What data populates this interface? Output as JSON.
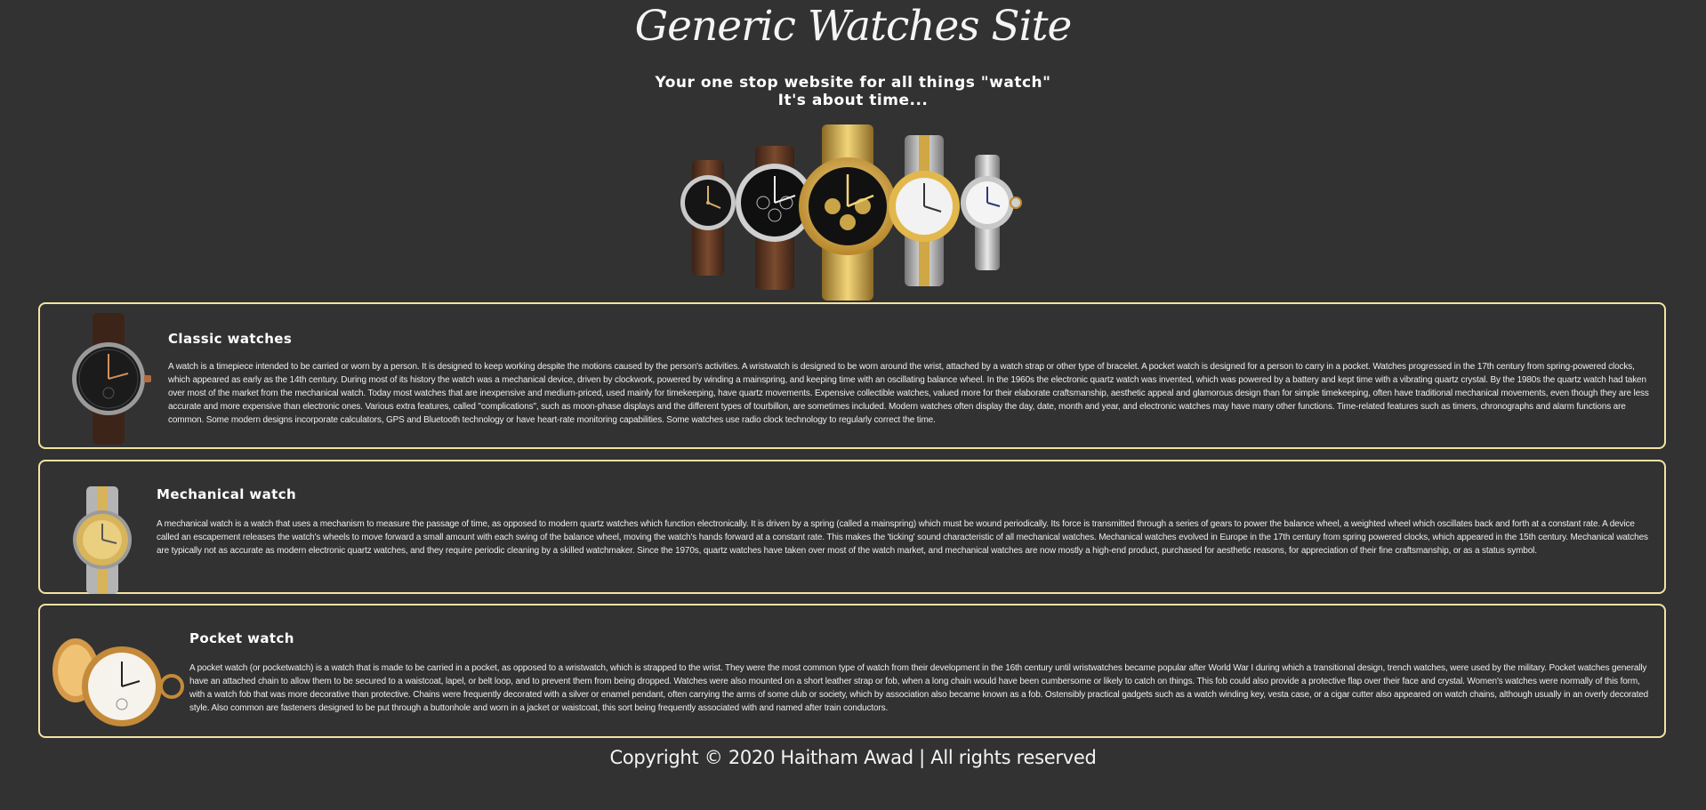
{
  "site": {
    "title": "Generic Watches Site",
    "tagline_line1": "Your one stop website for all things \"watch\"",
    "tagline_line2": "It's about time..."
  },
  "cards": [
    {
      "title": "Classic watches",
      "icon": "wristwatch-leather-icon",
      "text": "A watch is a timepiece intended to be carried or worn by a person. It is designed to keep working despite the motions caused by the person's activities. A wristwatch is designed to be worn around the wrist, attached by a watch strap or other type of bracelet. A pocket watch is designed for a person to carry in a pocket. Watches progressed in the 17th century from spring-powered clocks, which appeared as early as the 14th century. During most of its history the watch was a mechanical device, driven by clockwork, powered by winding a mainspring, and keeping time with an oscillating balance wheel. In the 1960s the electronic quartz watch was invented, which was powered by a battery and kept time with a vibrating quartz crystal. By the 1980s the quartz watch had taken over most of the market from the mechanical watch. Today most watches that are inexpensive and medium-priced, used mainly for timekeeping, have quartz movements. Expensive collectible watches, valued more for their elaborate craftsmanship, aesthetic appeal and glamorous design than for simple timekeeping, often have traditional mechanical movements, even though they are less accurate and more expensive than electronic ones. Various extra features, called \"complications\", such as moon-phase displays and the different types of tourbillon, are sometimes included. Modern watches often display the day, date, month and year, and electronic watches may have many other functions. Time-related features such as timers, chronographs and alarm functions are common. Some modern designs incorporate calculators, GPS and Bluetooth technology or have heart-rate monitoring capabilities. Some watches use radio clock technology to regularly correct the time."
    },
    {
      "title": "Mechanical watch",
      "icon": "wristwatch-gold-bracelet-icon",
      "text": "A mechanical watch is a watch that uses a mechanism to measure the passage of time, as opposed to modern quartz watches which function electronically. It is driven by a spring (called a mainspring) which must be wound periodically. Its force is transmitted through a series of gears to power the balance wheel, a weighted wheel which oscillates back and forth at a constant rate. A device called an escapement releases the watch's wheels to move forward a small amount with each swing of the balance wheel, moving the watch's hands forward at a constant rate. This makes the 'ticking' sound characteristic of all mechanical watches. Mechanical watches evolved in Europe in the 17th century from spring powered clocks, which appeared in the 15th century. Mechanical watches are typically not as accurate as modern electronic quartz watches, and they require periodic cleaning by a skilled watchmaker. Since the 1970s, quartz watches have taken over most of the watch market, and mechanical watches are now mostly a high-end product, purchased for aesthetic reasons, for appreciation of their fine craftsmanship, or as a status symbol."
    },
    {
      "title": "Pocket watch",
      "icon": "pocket-watch-icon",
      "text": "A pocket watch (or pocketwatch) is a watch that is made to be carried in a pocket, as opposed to a wristwatch, which is strapped to the wrist. They were the most common type of watch from their development in the 16th century until wristwatches became popular after World War I during which a transitional design, trench watches, were used by the military. Pocket watches generally have an attached chain to allow them to be secured to a waistcoat, lapel, or belt loop, and to prevent them from being dropped. Watches were also mounted on a short leather strap or fob, when a long chain would have been cumbersome or likely to catch on things. This fob could also provide a protective flap over their face and crystal. Women's watches were normally of this form, with a watch fob that was more decorative than protective. Chains were frequently decorated with a silver or enamel pendant, often carrying the arms of some club or society, which by association also became known as a fob. Ostensibly practical gadgets such as a watch winding key, vesta case, or a cigar cutter also appeared on watch chains, although usually in an overly decorated style. Also common are fasteners designed to be put through a buttonhole and worn in a jacket or waistcoat, this sort being frequently associated with and named after train conductors."
    }
  ],
  "hero": {
    "icon": "watch-collection-icon"
  },
  "footer": {
    "copyright": "Copyright © 2020 Haitham Awad | All rights reserved"
  },
  "colors": {
    "background": "#323232",
    "card_border": "#f3e3a2",
    "gold": "#d4a937",
    "text": "#f2f2f2"
  }
}
